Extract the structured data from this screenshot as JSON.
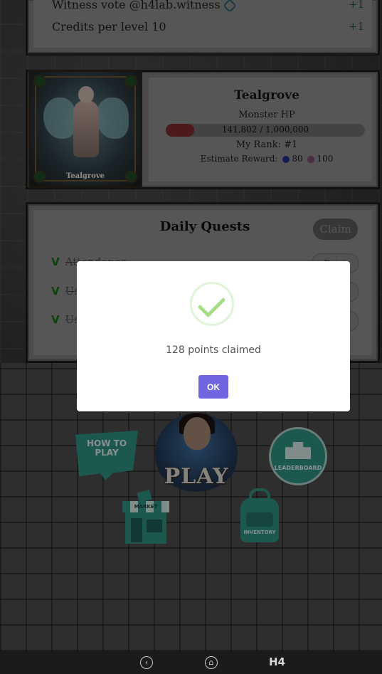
{
  "witness": {
    "rows": [
      {
        "label": "Witness vote @h4lab.witness",
        "value": "+1"
      },
      {
        "label": "Credits per level 10",
        "value": "+1"
      }
    ]
  },
  "monster": {
    "card_caption": "Tealgrove",
    "name": "Tealgrove",
    "hp_label": "Monster HP",
    "hp_text": "141,802 / 1,000,000",
    "hp_fraction": 0.1418,
    "rank_text": "My Rank: #1",
    "reward_label": "Estimate Reward:",
    "reward_a": "80",
    "reward_b": "100"
  },
  "quests": {
    "title": "Daily Quests",
    "claim_label": "Claim",
    "items": [
      {
        "check": "V",
        "name": "Attendance",
        "button": "Point"
      },
      {
        "check": "V",
        "name": "Us",
        "button": ""
      },
      {
        "check": "V",
        "name": "Us",
        "button": ""
      }
    ]
  },
  "menu": {
    "howto": "HOW TO PLAY",
    "play": "PLAY",
    "leaderboard": "LEADERBOARD",
    "market": "MARKET",
    "inventory": "INVENTORY"
  },
  "modal": {
    "message": "128 points claimed",
    "ok_label": "OK",
    "accent": "#7066e0",
    "success_color": "#a5dc86"
  },
  "navbar": {
    "back_icon": "back-icon",
    "home_icon": "home-icon",
    "logo": "H4"
  }
}
